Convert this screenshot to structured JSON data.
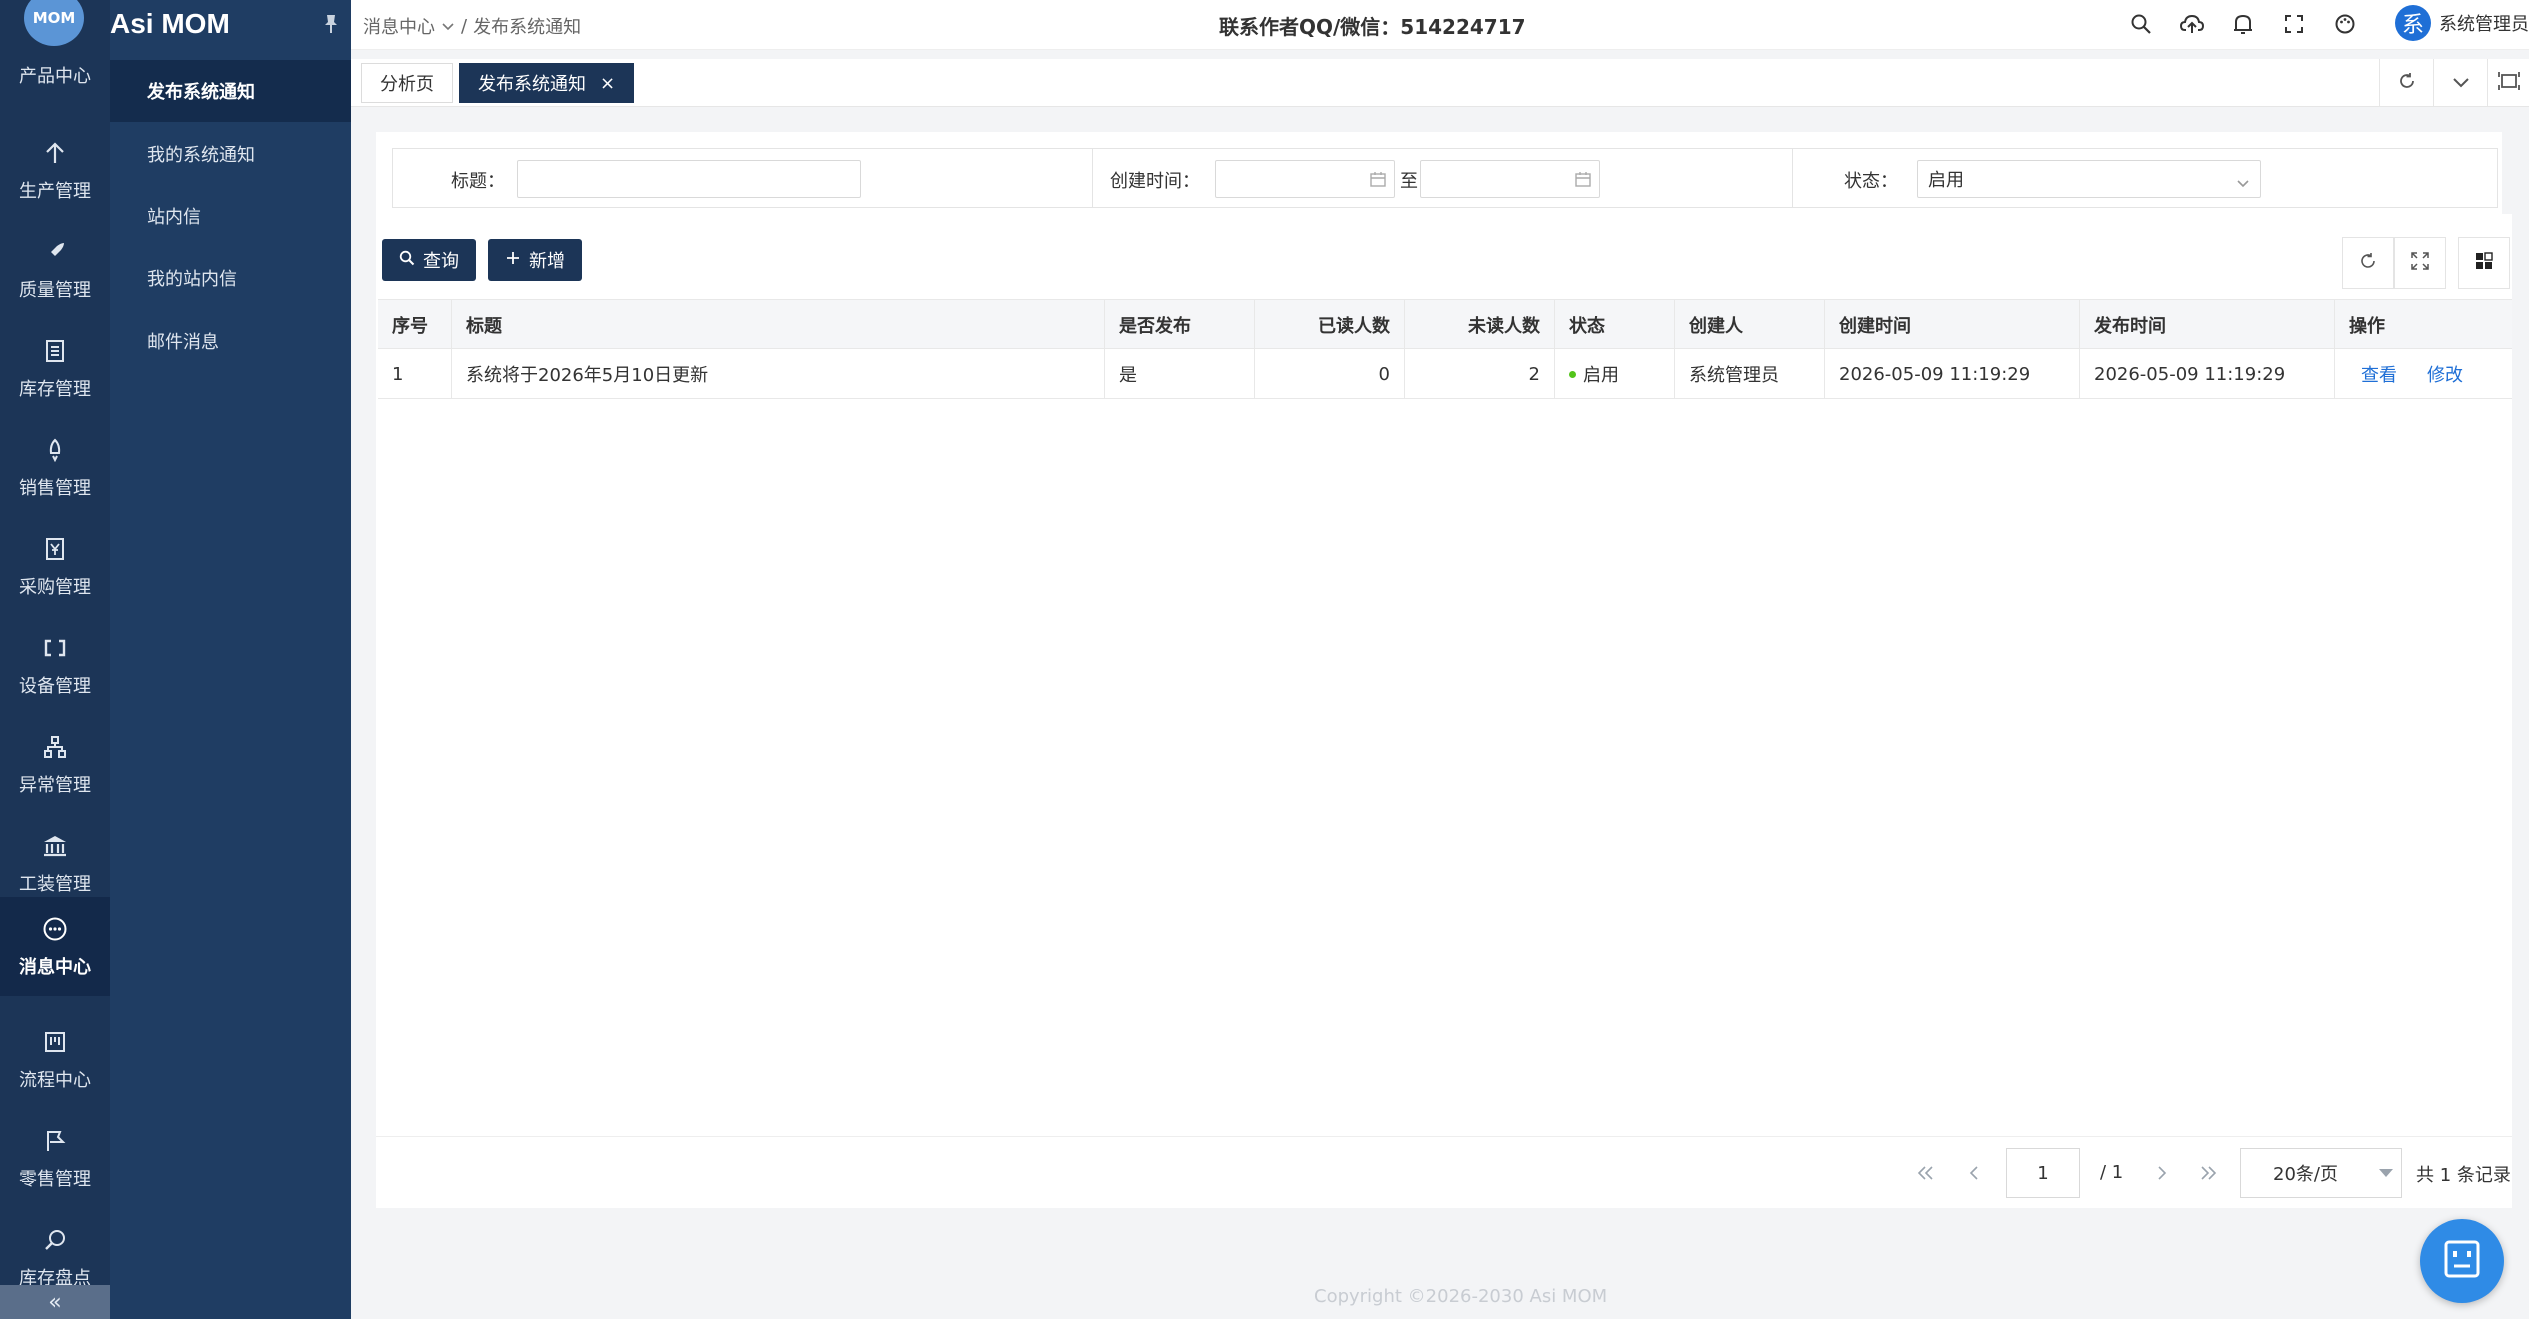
{
  "app": {
    "logo_text": "MOM",
    "title": "Asi MOM"
  },
  "rail": {
    "first_label": "产品中心",
    "items": [
      {
        "label": "生产管理",
        "icon": "arrow-up-icon"
      },
      {
        "label": "质量管理",
        "icon": "rocket-icon"
      },
      {
        "label": "库存管理",
        "icon": "document-icon"
      },
      {
        "label": "销售管理",
        "icon": "rocket-launch-icon"
      },
      {
        "label": "采购管理",
        "icon": "yen-icon"
      },
      {
        "label": "设备管理",
        "icon": "device-icon"
      },
      {
        "label": "异常管理",
        "icon": "hierarchy-icon"
      },
      {
        "label": "工装管理",
        "icon": "bank-icon"
      },
      {
        "label": "消息中心",
        "icon": "message-icon",
        "active": true
      },
      {
        "label": "流程中心",
        "icon": "flow-icon"
      },
      {
        "label": "零售管理",
        "icon": "flag-icon"
      },
      {
        "label": "库存盘点",
        "icon": "search-check-icon"
      }
    ],
    "collapse_label": "«"
  },
  "sidebar": {
    "items": [
      {
        "label": "发布系统通知",
        "active": true
      },
      {
        "label": "我的系统通知"
      },
      {
        "label": "站内信"
      },
      {
        "label": "我的站内信"
      },
      {
        "label": "邮件消息"
      }
    ]
  },
  "header": {
    "breadcrumb": [
      "消息中心",
      "/",
      "发布系统通知"
    ],
    "contact": "联系作者QQ/微信：514224717",
    "user_avatar": "系",
    "user_name": "系统管理员"
  },
  "tabs": [
    {
      "label": "分析页"
    },
    {
      "label": "发布系统通知",
      "active": true,
      "close": "×"
    }
  ],
  "filter": {
    "title_label": "标题：",
    "title_value": "",
    "created_label": "创建时间：",
    "range_sep": "至",
    "status_label": "状态：",
    "status_value": "启用"
  },
  "toolbar": {
    "query_label": "查询",
    "add_label": "新增"
  },
  "table": {
    "columns": [
      "序号",
      "标题",
      "是否发布",
      "已读人数",
      "未读人数",
      "状态",
      "创建人",
      "创建时间",
      "发布时间",
      "操作"
    ],
    "rows": [
      {
        "index": "1",
        "title": "系统将于2026年5月10日更新",
        "published": "是",
        "read": "0",
        "unread": "2",
        "status": "启用",
        "creator": "系统管理员",
        "created_at": "2026-05-09 11:19:29",
        "published_at": "2026-05-09 11:19:29",
        "action_view": "查看",
        "action_edit": "修改"
      }
    ]
  },
  "pagination": {
    "current_page": "1",
    "total_pages": "/ 1",
    "page_size": "20条/页",
    "records": "共 1 条记录"
  },
  "footer": {
    "copyright": "Copyright ©2026-2030 Asi MOM"
  },
  "colors": {
    "rail_bg": "#1c3557",
    "sidebar_bg": "#1f3d63",
    "accent": "#1c3557",
    "link": "#1f6fd6",
    "status_dot": "#52c41a"
  }
}
